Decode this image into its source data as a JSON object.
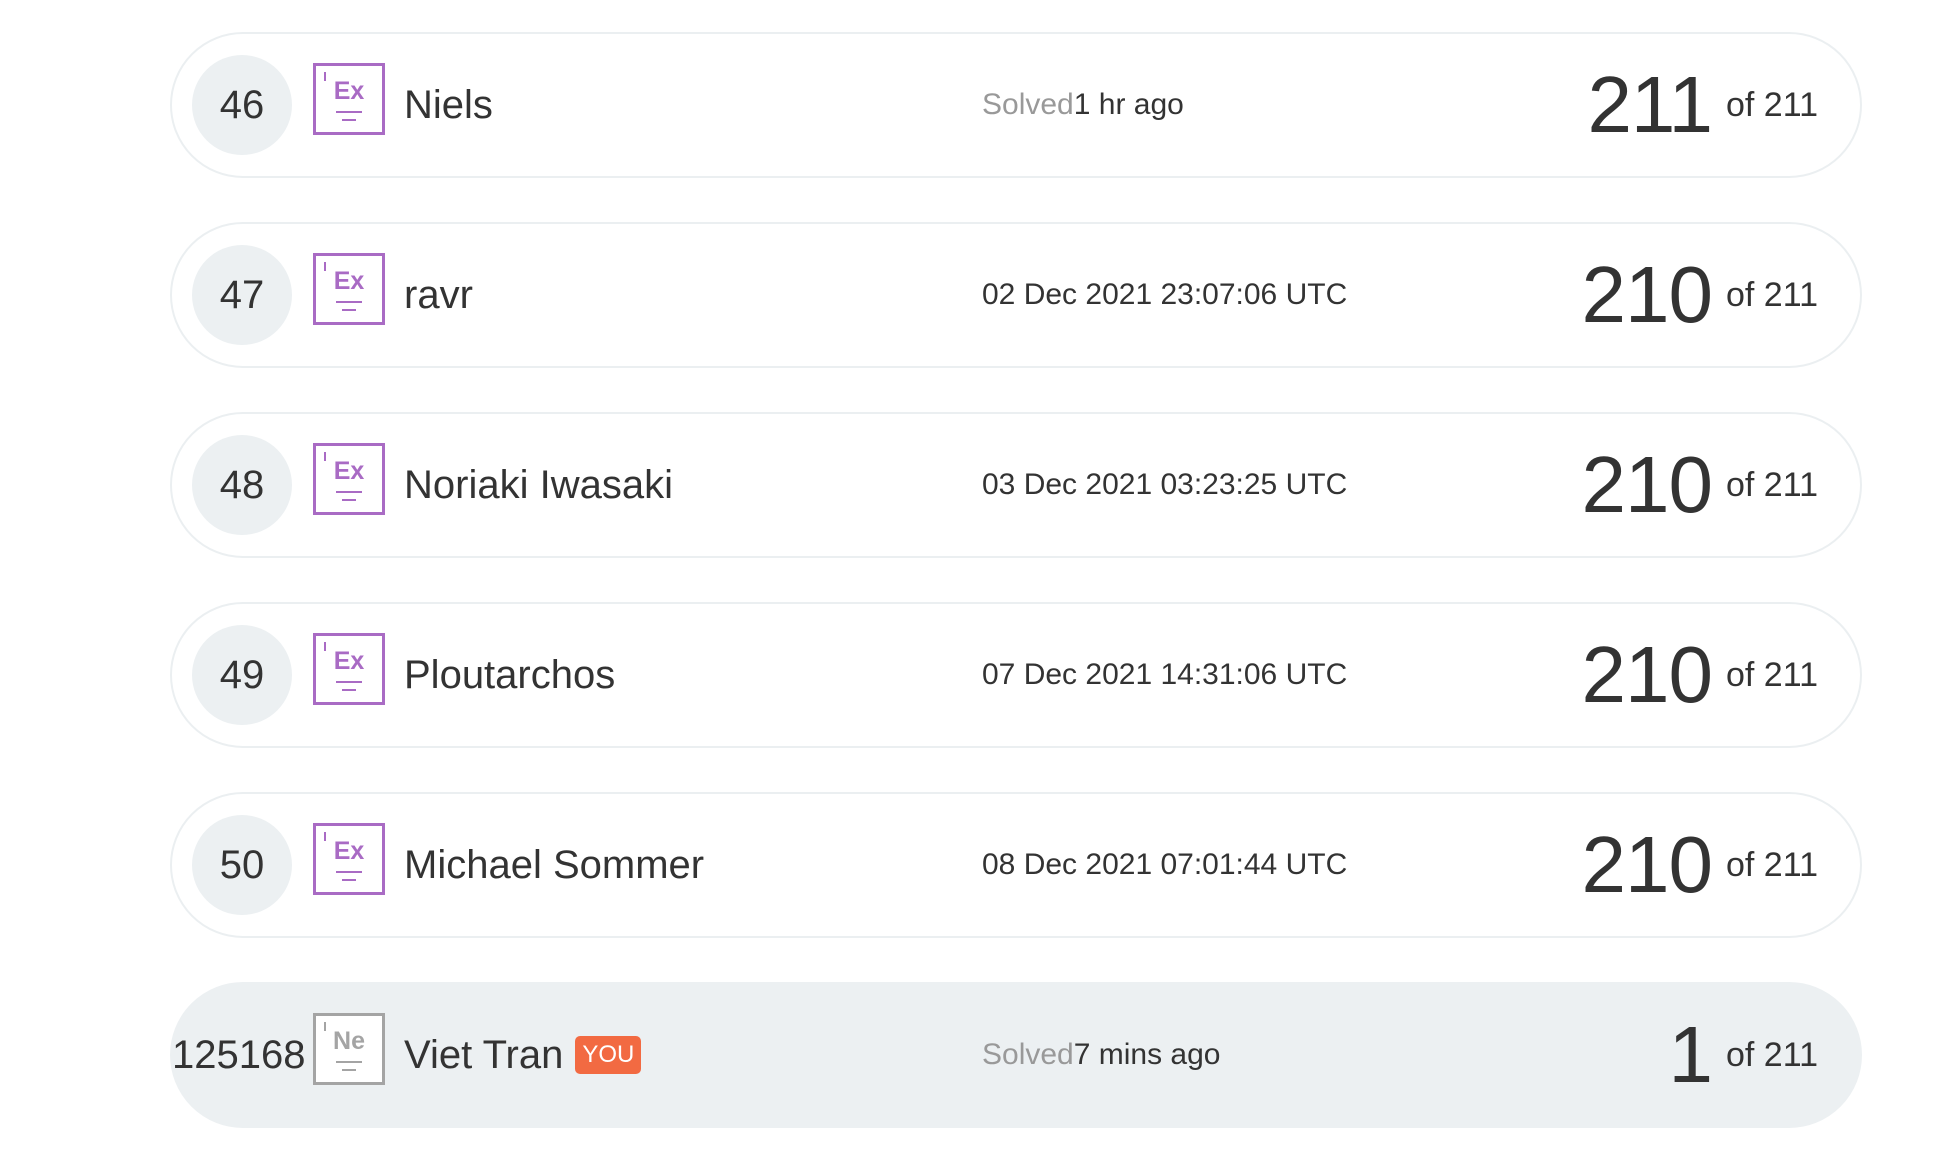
{
  "leaderboard": {
    "rows": [
      {
        "rank": "46",
        "badge": "Ex",
        "name": "Niels",
        "when_prefix": "Solved",
        "when": "1 hr ago",
        "solved": "211",
        "total": "of 211"
      },
      {
        "rank": "47",
        "badge": "Ex",
        "name": "ravr",
        "when_prefix": "",
        "when": "02 Dec 2021 23:07:06 UTC",
        "solved": "210",
        "total": "of 211"
      },
      {
        "rank": "48",
        "badge": "Ex",
        "name": "Noriaki Iwasaki",
        "when_prefix": "",
        "when": "03 Dec 2021 03:23:25 UTC",
        "solved": "210",
        "total": "of 211"
      },
      {
        "rank": "49",
        "badge": "Ex",
        "name": "Ploutarchos",
        "when_prefix": "",
        "when": "07 Dec 2021 14:31:06 UTC",
        "solved": "210",
        "total": "of 211"
      },
      {
        "rank": "50",
        "badge": "Ex",
        "name": "Michael Sommer",
        "when_prefix": "",
        "when": "08 Dec 2021 07:01:44 UTC",
        "solved": "210",
        "total": "of 211"
      }
    ],
    "you_row": {
      "rank": "125168",
      "badge": "Ne",
      "name": "Viet Tran",
      "you_label": "YOU",
      "when_prefix": "Solved",
      "when": "7 mins ago",
      "solved": "1",
      "total": "of 211"
    }
  },
  "colors": {
    "badge_expert": "#a96bc4",
    "badge_newbie": "#a4a4a4",
    "you_tag": "#f26a42",
    "row_highlight": "#ecf0f2"
  }
}
